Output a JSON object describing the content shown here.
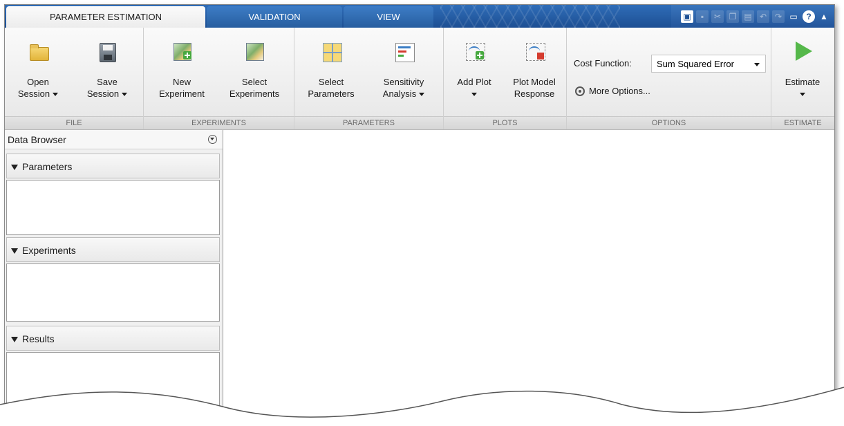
{
  "tabs": {
    "parameter_estimation": "PARAMETER ESTIMATION",
    "validation": "VALIDATION",
    "view": "VIEW"
  },
  "quick_access": [
    "new-icon",
    "save-icon",
    "cut-icon",
    "copy-icon",
    "paste-icon",
    "undo-icon",
    "redo-icon",
    "window-icon",
    "help-icon",
    "minimize-ribbon-icon"
  ],
  "ribbon": {
    "file": {
      "label": "FILE",
      "open_line1": "Open",
      "open_line2": "Session",
      "save_line1": "Save",
      "save_line2": "Session"
    },
    "experiments": {
      "label": "EXPERIMENTS",
      "new_line1": "New",
      "new_line2": "Experiment",
      "select_line1": "Select",
      "select_line2": "Experiments"
    },
    "parameters": {
      "label": "PARAMETERS",
      "select_line1": "Select",
      "select_line2": "Parameters",
      "sens_line1": "Sensitivity",
      "sens_line2": "Analysis"
    },
    "plots": {
      "label": "PLOTS",
      "add_line1": "Add Plot",
      "plotmodel_line1": "Plot Model",
      "plotmodel_line2": "Response"
    },
    "options": {
      "label": "OPTIONS",
      "cost_function_label": "Cost Function:",
      "cost_function_value": "Sum Squared Error",
      "more_options": "More Options..."
    },
    "estimate": {
      "label": "ESTIMATE",
      "button": "Estimate"
    }
  },
  "browser": {
    "title": "Data Browser",
    "panels": [
      "Parameters",
      "Experiments",
      "Results"
    ]
  },
  "colors": {
    "tab_blue": "#1d4f93",
    "estimate_green": "#55b84a"
  }
}
